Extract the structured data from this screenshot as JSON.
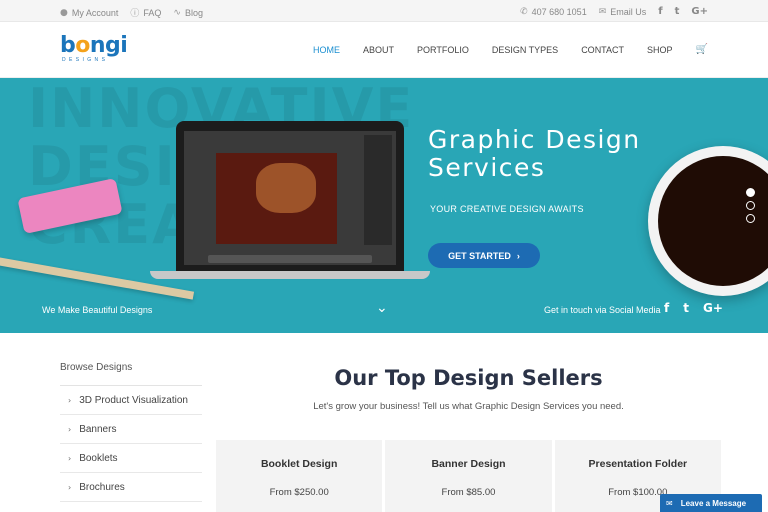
{
  "topbar": {
    "links": [
      {
        "icon": "user-icon",
        "glyph": "👤",
        "label": "My Account"
      },
      {
        "icon": "question-icon",
        "glyph": "?",
        "label": "FAQ"
      },
      {
        "icon": "rss-icon",
        "glyph": "◉",
        "label": "Blog"
      }
    ],
    "phone": "407 680 1051",
    "email_label": "Email Us",
    "social": [
      "f",
      "t",
      "G+"
    ]
  },
  "header": {
    "logo": {
      "text_pre": "b",
      "text_o": "o",
      "text_post": "ngi",
      "sub": "DESIGNS"
    },
    "nav": [
      "HOME",
      "PORTFOLIO",
      "ABOUT",
      "DESIGN TYPES",
      "CONTACT",
      "SHOP"
    ],
    "active_nav": "HOME"
  },
  "hero": {
    "bg_text": "INNOVATIVE\nDESIGN\nCREATIONS",
    "title": "Graphic Design Services",
    "subtitle": "YOUR CREATIVE DESIGN AWAITS",
    "cta": "GET STARTED",
    "left_text": "We Make Beautiful Designs",
    "right_text": "Get in touch via Social Media",
    "social": [
      "f",
      "t",
      "G+"
    ],
    "slides_total": 3,
    "slide_active": 1,
    "colors": {
      "hero_bg": "#29a6b6",
      "cta": "#1d6bb3"
    }
  },
  "sidebar": {
    "title": "Browse Designs",
    "items": [
      "3D Product Visualization",
      "Banners",
      "Booklets",
      "Brochures"
    ]
  },
  "main": {
    "title": "Our Top Design Sellers",
    "subtitle": "Let's grow your business! Tell us what Graphic Design Services you need.",
    "cards": [
      {
        "name": "Booklet Design",
        "price": "From $250.00"
      },
      {
        "name": "Banner Design",
        "price": "From $85.00"
      },
      {
        "name": "Presentation Folder",
        "price": "From $100.00"
      }
    ]
  },
  "message_tab": {
    "label": "Leave a Message"
  }
}
